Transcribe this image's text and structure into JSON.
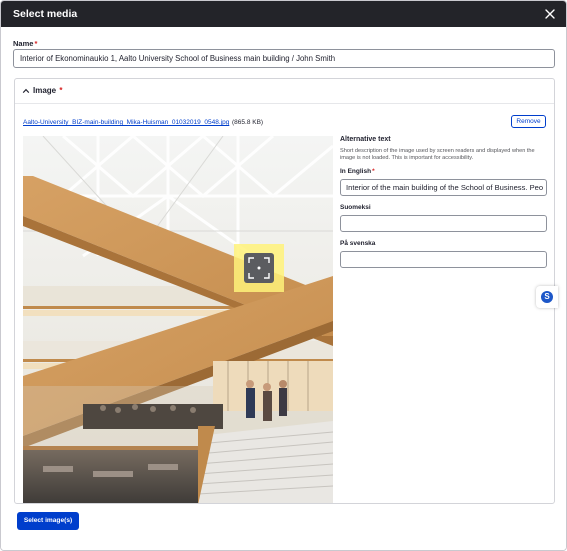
{
  "dialog": {
    "title": "Select media",
    "close_icon": "close-icon"
  },
  "name_field": {
    "label": "Name",
    "required_mark": "*",
    "value": "Interior of Ekonominaukio 1, Aalto University School of Business main building / John Smith"
  },
  "image_section": {
    "label": "Image",
    "required_mark": "*",
    "toggle_icon": "chevron-up-icon",
    "file_name": "Aalto-University_BIZ-main-building_Mika-Huisman_01032019_0548.jpg",
    "file_size": "(865.8 KB)",
    "remove_label": "Remove",
    "focal_point_icon": "focus-frame-icon"
  },
  "alt_text": {
    "title": "Alternative text",
    "description": "Short description of the image used by screen readers and displayed when the image is not loaded. This is important for accessibility.",
    "english_label": "In English",
    "english_required": "*",
    "english_value": "Interior of the main building of the School of Business. Peo",
    "finnish_label": "Suomeksi",
    "finnish_value": "",
    "swedish_label": "På svenska",
    "swedish_value": ""
  },
  "floating_widget": {
    "letter": "S",
    "color": "#1d57c8"
  },
  "footer": {
    "select_label": "Select image(s)"
  },
  "colors": {
    "titlebar": "#232429",
    "primary": "#003ecc",
    "required": "#d72222",
    "focal_highlight": "#fff27a"
  }
}
